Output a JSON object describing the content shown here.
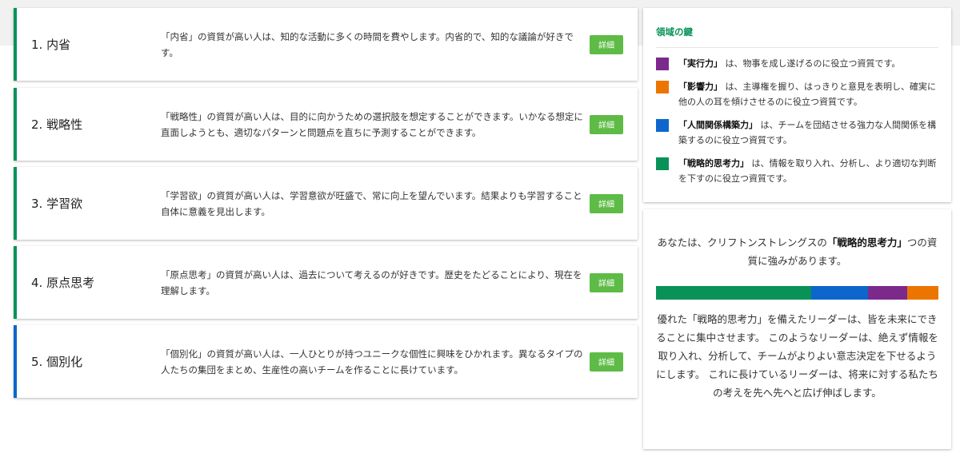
{
  "themes": [
    {
      "name": "1. 内省",
      "desc": "「内省」の資質が高い人は、知的な活動に多くの時間を費やします。内省的で、知的な議論が好きです。",
      "button": "詳細",
      "domain_color": "#089258"
    },
    {
      "name": "2. 戦略性",
      "desc": "「戦略性」の資質が高い人は、目的に向かうための選択肢を想定することができます。いかなる想定に直面しようとも、適切なパターンと問題点を直ちに予測することができます。",
      "button": "詳細",
      "domain_color": "#089258"
    },
    {
      "name": "3. 学習欲",
      "desc": "「学習欲」の資質が高い人は、学習意欲が旺盛で、常に向上を望んでいます。結果よりも学習すること自体に意義を見出します。",
      "button": "詳細",
      "domain_color": "#089258"
    },
    {
      "name": "4. 原点思考",
      "desc": "「原点思考」の資質が高い人は、過去について考えるのが好きです。歴史をたどることにより、現在を理解します。",
      "button": "詳細",
      "domain_color": "#089258"
    },
    {
      "name": "5. 個別化",
      "desc": "「個別化」の資質が高い人は、一人ひとりが持つユニークな個性に興味をひかれます。異なるタイプの人たちの集団をまとめ、生産性の高いチームを作ることに長けています。",
      "button": "詳細",
      "domain_color": "#0d66cc"
    }
  ],
  "key": {
    "title": "領域の鍵",
    "items": [
      {
        "label": "「実行力」",
        "text": "は、物事を成し遂げるのに役立つ資質です。",
        "color": "#7b2a8b"
      },
      {
        "label": "「影響力」",
        "text": "は、主導権を握り、はっきりと意見を表明し、確実に他の人の耳を傾けさせるのに役立つ資質です。",
        "color": "#ec7500"
      },
      {
        "label": "「人間関係構築力」",
        "text": "は、チームを団結させる強力な人間関係を構築するのに役立つ資質です。",
        "color": "#0d66cc"
      },
      {
        "label": "「戦略的思考力」",
        "text": "は、情報を取り入れ、分析し、より適切な判断を下すのに役立つ資質です。",
        "color": "#089258"
      }
    ]
  },
  "summary": {
    "pre": "あなたは、クリフトンストレングスの",
    "strong": "「戦略的思考力」",
    "post": "つの資質に強みがあります。",
    "bar": [
      {
        "color": "#089258",
        "fraction": 0.55
      },
      {
        "color": "#0d66cc",
        "fraction": 0.2
      },
      {
        "color": "#7b2a8b",
        "fraction": 0.14
      },
      {
        "color": "#ec7500",
        "fraction": 0.11
      }
    ],
    "body": "優れた「戦略的思考力」を備えたリーダーは、皆を未来にできることに集中させます。 このようなリーダーは、絶えず情報を取り入れ、分析して、チームがよりよい意志決定を下せるようにします。 これに長けているリーダーは、将来に対する私たちの考えを先へ先へと広げ伸ばします。"
  }
}
